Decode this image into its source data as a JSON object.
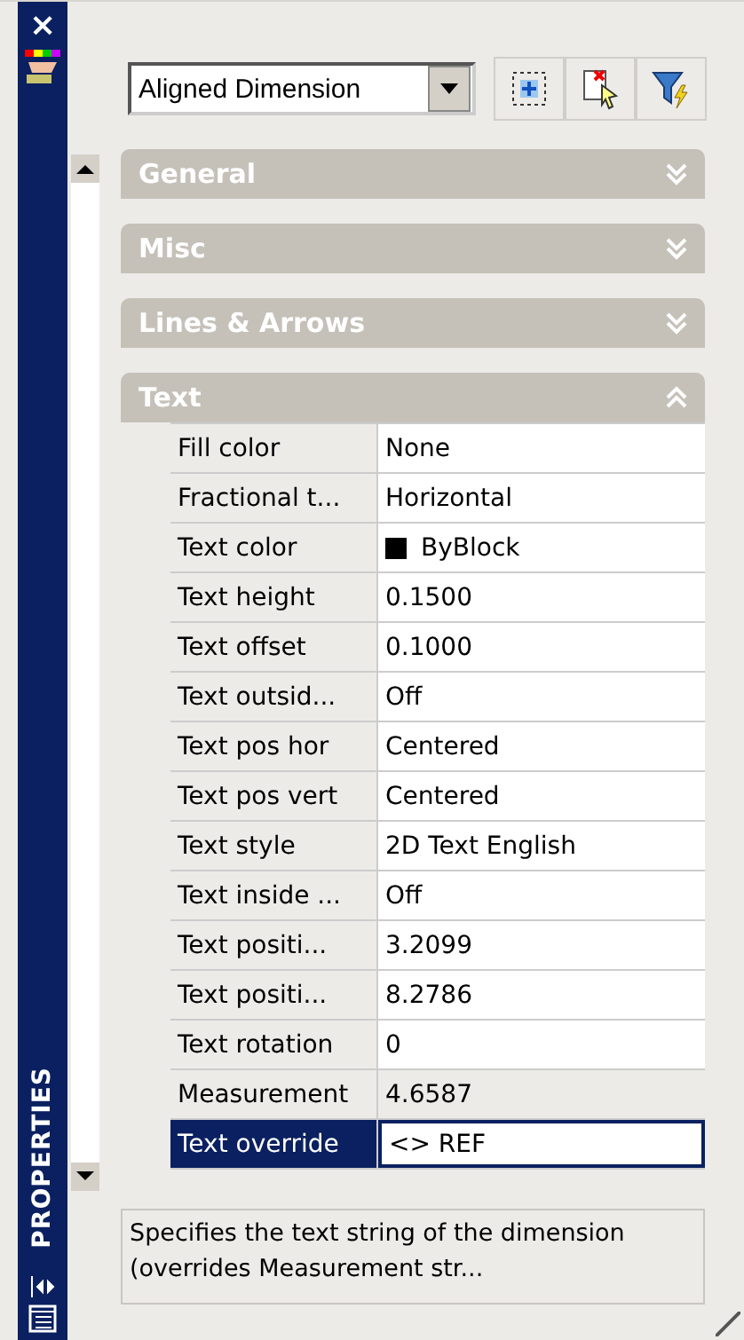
{
  "sidebar": {
    "close": "×",
    "title": "PROPERTIES"
  },
  "selector": {
    "value": "Aligned Dimension"
  },
  "sections": [
    {
      "title": "General",
      "expanded": false
    },
    {
      "title": "Misc",
      "expanded": false
    },
    {
      "title": "Lines & Arrows",
      "expanded": false
    },
    {
      "title": "Text",
      "expanded": true,
      "rows": [
        {
          "name": "Fill color",
          "value": "None",
          "selected": false,
          "readonly": false
        },
        {
          "name": "Fractional t...",
          "value": "Horizontal",
          "selected": false,
          "readonly": false
        },
        {
          "name": "Text color",
          "value": "ByBlock",
          "color": "#000000",
          "selected": false,
          "readonly": false
        },
        {
          "name": "Text height",
          "value": "0.1500",
          "selected": false,
          "readonly": false
        },
        {
          "name": "Text offset",
          "value": "0.1000",
          "selected": false,
          "readonly": false
        },
        {
          "name": "Text outsid...",
          "value": "Off",
          "selected": false,
          "readonly": false
        },
        {
          "name": "Text pos hor",
          "value": "Centered",
          "selected": false,
          "readonly": false
        },
        {
          "name": "Text pos vert",
          "value": "Centered",
          "selected": false,
          "readonly": false
        },
        {
          "name": "Text style",
          "value": "2D Text English",
          "selected": false,
          "readonly": false
        },
        {
          "name": "Text inside ...",
          "value": "Off",
          "selected": false,
          "readonly": false
        },
        {
          "name": "Text positi...",
          "value": "3.2099",
          "selected": false,
          "readonly": false
        },
        {
          "name": "Text positi...",
          "value": "8.2786",
          "selected": false,
          "readonly": false
        },
        {
          "name": "Text rotation",
          "value": "0",
          "selected": false,
          "readonly": false
        },
        {
          "name": "Measurement",
          "value": "4.6587",
          "selected": false,
          "readonly": true
        },
        {
          "name": "Text override",
          "value": "<> REF",
          "selected": true,
          "readonly": false
        }
      ]
    }
  ],
  "description": "Specifies the text string of the dimension (overrides Measurement str..."
}
